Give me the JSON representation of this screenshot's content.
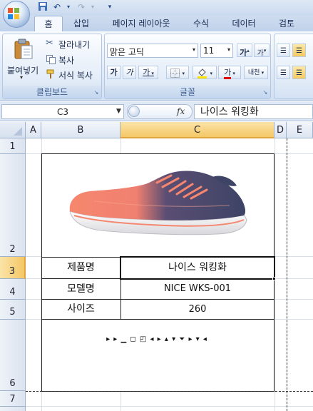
{
  "ribbon": {
    "tabs": [
      "홈",
      "삽입",
      "페이지 레이아웃",
      "수식",
      "데이터",
      "검토"
    ],
    "clipboard": {
      "paste_label": "붙여넣기",
      "cut_label": "잘라내기",
      "copy_label": "복사",
      "format_painter_label": "서식 복사",
      "group_label": "클립보드"
    },
    "font": {
      "font_name": "맑은 고딕",
      "font_size": "11",
      "grow_label": "가",
      "shrink_label": "가",
      "bold_label": "가",
      "italic_label": "가",
      "underline_label": "가",
      "font_color_label": "가",
      "phonetic_label": "내천",
      "group_label": "글꼴"
    }
  },
  "formula_bar": {
    "name_box": "C3",
    "fx": "fx",
    "content": "나이스 워킹화"
  },
  "sheet": {
    "columns": [
      "A",
      "B",
      "C",
      "D",
      "E"
    ],
    "rows": [
      "1",
      "2",
      "3",
      "4",
      "5",
      "6",
      "7"
    ],
    "selected_cell": "C3",
    "table": [
      {
        "label": "제품명",
        "value": "나이스 워킹화"
      },
      {
        "label": "모델명",
        "value": "NICE WKS-001"
      },
      {
        "label": "사이즈",
        "value": "260"
      }
    ],
    "symbols_row": "▸ ▸ ▁ ◻ ◰ ◂ ▸ ▴ ▾ ⏷ ▸ ▾ ◂"
  },
  "colors": {
    "selection": "#f5c766",
    "shoe_coral": "#f6876e",
    "shoe_navy": "#3d4466"
  }
}
